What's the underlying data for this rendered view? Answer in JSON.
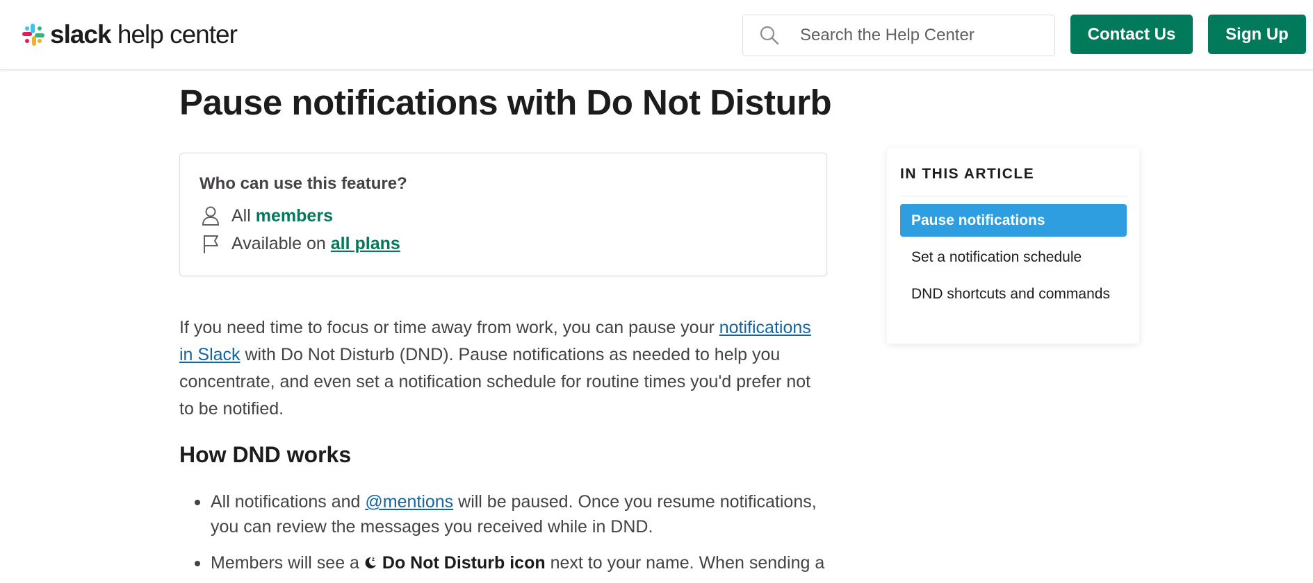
{
  "header": {
    "logo_bold": "slack",
    "logo_rest": " help center",
    "search_placeholder": "Search the Help Center",
    "contact_label": "Contact Us",
    "signup_label": "Sign Up"
  },
  "article": {
    "title": "Pause notifications with Do Not Disturb",
    "feature_box": {
      "title": "Who can use this feature?",
      "row1_prefix": "All",
      "row1_highlight": "members",
      "row2_prefix": "Available on",
      "row2_link": "all plans"
    },
    "intro": {
      "part1": "If you need time to focus or time away from work, you can pause your ",
      "link": "notifications in Slack",
      "part2": " with Do Not Disturb (DND). Pause notifications as needed to help you concentrate, and even set a notification schedule for routine times you'd prefer not to be notified."
    },
    "section_heading": "How DND works",
    "bullet1": {
      "part1": "All notifications and ",
      "link": "@mentions",
      "part2": " will be paused. Once you resume notifications, you can review the messages you received while in DND."
    },
    "bullet2": {
      "part1": "Members will see a ",
      "bold": "Do Not Disturb icon",
      "part2": " next to your name. When sending a"
    }
  },
  "toc": {
    "heading": "IN THIS ARTICLE",
    "items": [
      {
        "label": "Pause notifications",
        "active": true
      },
      {
        "label": "Set a notification schedule",
        "active": false
      },
      {
        "label": "DND shortcuts and commands",
        "active": false
      }
    ]
  },
  "colors": {
    "brand_green": "#007a5a",
    "link_blue": "#1264a3",
    "toc_active": "#2e9ee0"
  },
  "icons": [
    "slack-logo-icon",
    "search-icon",
    "user-icon",
    "flag-icon",
    "dnd-moon-icon"
  ]
}
